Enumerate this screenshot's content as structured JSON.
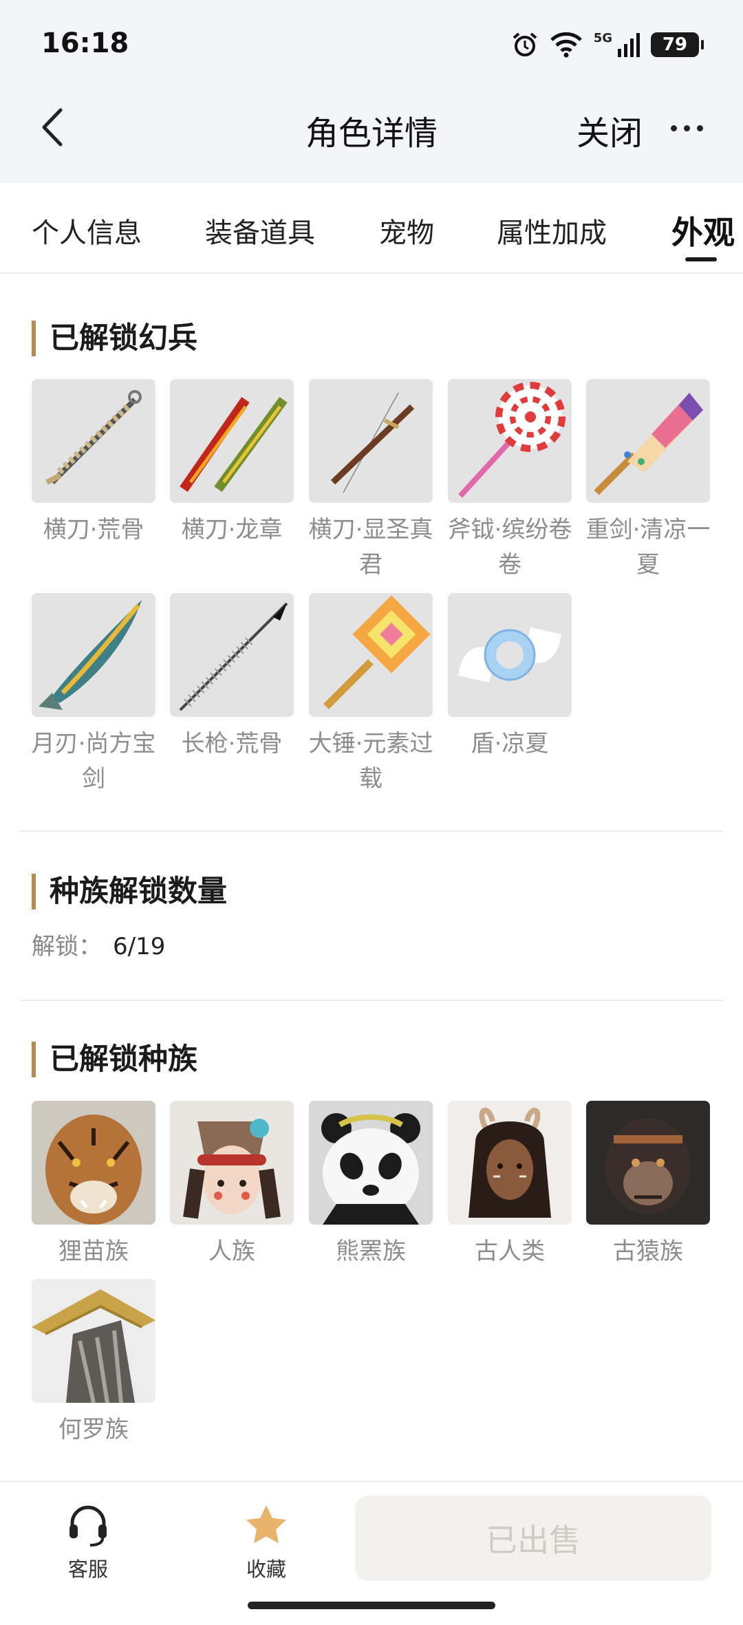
{
  "status_bar": {
    "time": "16:18",
    "battery": "79",
    "network": "5G"
  },
  "nav": {
    "title": "角色详情",
    "close_label": "关闭"
  },
  "tabs": [
    {
      "label": "个人信息"
    },
    {
      "label": "装备道具"
    },
    {
      "label": "宠物"
    },
    {
      "label": "属性加成"
    },
    {
      "label": "外观",
      "active": true
    }
  ],
  "weapons_section": {
    "title": "已解锁幻兵",
    "items": [
      {
        "caption": "横刀·荒骨",
        "icon": "bone-sword-icon"
      },
      {
        "caption": "横刀·龙章",
        "icon": "flame-sword-icon"
      },
      {
        "caption": "横刀·显圣真君",
        "icon": "twin-blade-icon"
      },
      {
        "caption": "斧钺·缤纷卷卷",
        "icon": "lollipop-axe-icon"
      },
      {
        "caption": "重剑·清凉一夏",
        "icon": "popsicle-sword-icon"
      },
      {
        "caption": "月刃·尚方宝剑",
        "icon": "fish-blade-icon"
      },
      {
        "caption": "长枪·荒骨",
        "icon": "bone-spear-icon"
      },
      {
        "caption": "大锤·元素过载",
        "icon": "pixel-hammer-icon"
      },
      {
        "caption": "盾·凉夏",
        "icon": "candy-shield-icon"
      }
    ]
  },
  "race_count_section": {
    "title": "种族解锁数量",
    "label": "解锁：",
    "value": "6/19"
  },
  "races_section": {
    "title": "已解锁种族",
    "items": [
      {
        "caption": "狸苗族",
        "icon": "tiger-portrait-icon"
      },
      {
        "caption": "人族",
        "icon": "human-girl-portrait-icon"
      },
      {
        "caption": "熊罴族",
        "icon": "panda-portrait-icon"
      },
      {
        "caption": "古人类",
        "icon": "tribal-girl-portrait-icon"
      },
      {
        "caption": "古猿族",
        "icon": "ape-portrait-icon"
      },
      {
        "caption": "何罗族",
        "icon": "straw-hat-figure-icon"
      }
    ]
  },
  "bottom_bar": {
    "service_label": "客服",
    "favorite_label": "收藏",
    "sold_label": "已出售"
  },
  "colors": {
    "section_accent": "#b98a52",
    "favorite_star": "#e8b36a",
    "sold_text": "#d0ccc4",
    "sold_bg": "#f2f1ee",
    "header_bg": "#f4f5f8"
  }
}
